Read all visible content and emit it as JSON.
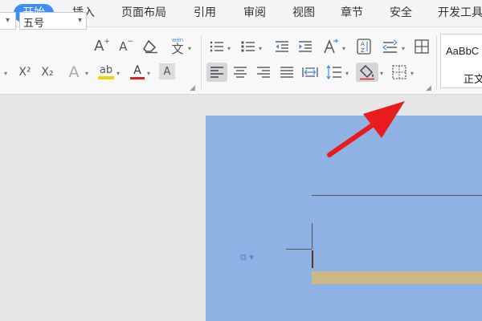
{
  "menu": {
    "tabs": [
      {
        "label": "开始",
        "active": true
      },
      {
        "label": "插入"
      },
      {
        "label": "页面布局"
      },
      {
        "label": "引用"
      },
      {
        "label": "审阅"
      },
      {
        "label": "视图"
      },
      {
        "label": "章节"
      },
      {
        "label": "安全"
      },
      {
        "label": "开发工具"
      }
    ]
  },
  "ribbon": {
    "font_size": "五号",
    "glyphs": {
      "increase_font": "A",
      "decrease_font": "A",
      "phonetic": "文",
      "phonetic_sup": "wén",
      "superscript": "X²",
      "subscript": "X₂",
      "text_effect": "A",
      "highlight": "ab",
      "font_color": "A",
      "char_shading": "A"
    },
    "styles": {
      "sample": "AaBbC",
      "name": "正文"
    }
  },
  "colors": {
    "accent": "#3e8ef7",
    "page": "#8db2e3",
    "highlight_yellow": "#f2d600",
    "font_color_red": "#e02020",
    "arrow": "#e81c1c"
  }
}
